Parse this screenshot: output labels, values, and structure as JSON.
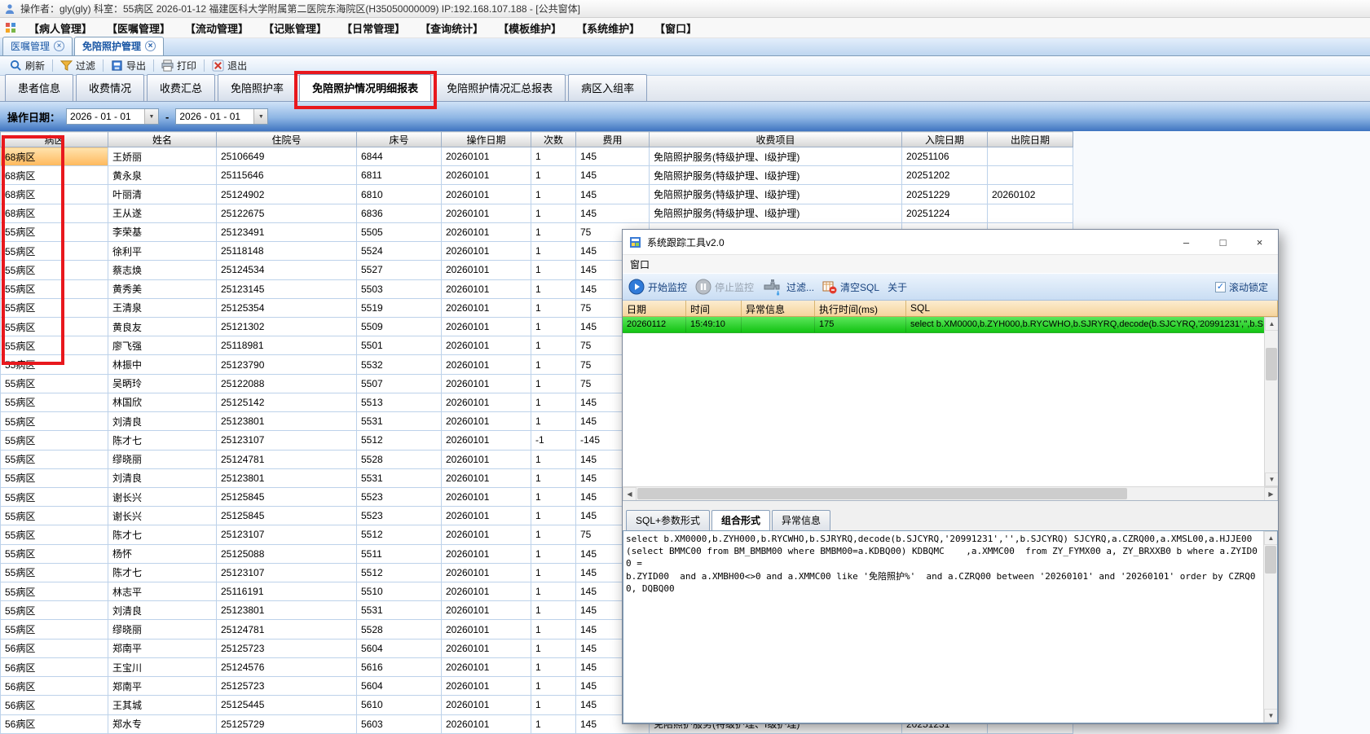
{
  "colors": {
    "annotation_red": "#e8181d",
    "selected_cell_orange": "#ffb85c",
    "trace_row_green": "#12c312",
    "filter_band_blue": "#3f74c0"
  },
  "icons": {
    "chevron_down": "▼",
    "scroll_left": "◀",
    "scroll_right": "▶",
    "scroll_up": "▲",
    "scroll_down": "▼",
    "check": "✓",
    "close": "×"
  },
  "titlebar": {
    "text": "操作者：gly(gly)  科室：55病区  2026-01-12  福建医科大学附属第二医院东海院区(H35050000009) IP:192.168.107.188 - [公共窗体]"
  },
  "menubar": {
    "items": [
      "【病人管理】",
      "【医嘱管理】",
      "【流动管理】",
      "【记账管理】",
      "【日常管理】",
      "【查询统计】",
      "【模板维护】",
      "【系统维护】",
      "【窗口】"
    ]
  },
  "doc_tabs": [
    {
      "label": "医嘱管理",
      "active": false
    },
    {
      "label": "免陪照护管理",
      "active": true
    }
  ],
  "toolbar": {
    "buttons": [
      {
        "name": "refresh",
        "label": "刷新",
        "icon": "magnifier-icon"
      },
      {
        "name": "filter",
        "label": "过滤",
        "icon": "funnel-icon"
      },
      {
        "name": "export",
        "label": "导出",
        "icon": "export-icon"
      },
      {
        "name": "print",
        "label": "打印",
        "icon": "print-icon"
      },
      {
        "name": "exit",
        "label": "退出",
        "icon": "exit-icon"
      }
    ]
  },
  "sub_tabs": [
    {
      "label": "患者信息",
      "active": false,
      "annotated": false
    },
    {
      "label": "收费情况",
      "active": false,
      "annotated": false
    },
    {
      "label": "收费汇总",
      "active": false,
      "annotated": false
    },
    {
      "label": "免陪照护率",
      "active": false,
      "annotated": false
    },
    {
      "label": "免陪照护情况明细报表",
      "active": true,
      "annotated": true
    },
    {
      "label": "免陪照护情况汇总报表",
      "active": false,
      "annotated": false
    },
    {
      "label": "病区入组率",
      "active": false,
      "annotated": false
    }
  ],
  "filter": {
    "label": "操作日期：",
    "from": "2026 - 01 - 01",
    "separator": "-",
    "to": "2026 - 01 - 01"
  },
  "table": {
    "columns": [
      "病区",
      "姓名",
      "住院号",
      "床号",
      "操作日期",
      "次数",
      "费用",
      "收费项目",
      "入院日期",
      "出院日期"
    ],
    "selected_cell": {
      "row": 0,
      "col": 0
    },
    "rows": [
      [
        "68病区",
        "王娇丽",
        "25106649",
        "6844",
        "20260101",
        "1",
        "145",
        "免陪照护服务(特级护理、I级护理)",
        "20251106",
        ""
      ],
      [
        "68病区",
        "黄永泉",
        "25115646",
        "6811",
        "20260101",
        "1",
        "145",
        "免陪照护服务(特级护理、I级护理)",
        "20251202",
        ""
      ],
      [
        "68病区",
        "叶丽清",
        "25124902",
        "6810",
        "20260101",
        "1",
        "145",
        "免陪照护服务(特级护理、I级护理)",
        "20251229",
        "20260102"
      ],
      [
        "68病区",
        "王从遂",
        "25122675",
        "6836",
        "20260101",
        "1",
        "145",
        "免陪照护服务(特级护理、I级护理)",
        "20251224",
        ""
      ],
      [
        "55病区",
        "李荣基",
        "25123491",
        "5505",
        "20260101",
        "1",
        "75",
        "",
        "",
        ""
      ],
      [
        "55病区",
        "徐利平",
        "25118148",
        "5524",
        "20260101",
        "1",
        "145",
        "",
        "",
        ""
      ],
      [
        "55病区",
        "蔡志焕",
        "25124534",
        "5527",
        "20260101",
        "1",
        "145",
        "",
        "",
        ""
      ],
      [
        "55病区",
        "黄秀美",
        "25123145",
        "5503",
        "20260101",
        "1",
        "145",
        "",
        "",
        ""
      ],
      [
        "55病区",
        "王清泉",
        "25125354",
        "5519",
        "20260101",
        "1",
        "75",
        "",
        "",
        ""
      ],
      [
        "55病区",
        "黄良友",
        "25121302",
        "5509",
        "20260101",
        "1",
        "145",
        "",
        "",
        ""
      ],
      [
        "55病区",
        "廖飞强",
        "25118981",
        "5501",
        "20260101",
        "1",
        "75",
        "",
        "",
        ""
      ],
      [
        "55病区",
        "林振中",
        "25123790",
        "5532",
        "20260101",
        "1",
        "75",
        "",
        "",
        ""
      ],
      [
        "55病区",
        "吴昞玲",
        "25122088",
        "5507",
        "20260101",
        "1",
        "75",
        "",
        "",
        ""
      ],
      [
        "55病区",
        "林国欣",
        "25125142",
        "5513",
        "20260101",
        "1",
        "145",
        "",
        "",
        ""
      ],
      [
        "55病区",
        "刘清良",
        "25123801",
        "5531",
        "20260101",
        "1",
        "145",
        "",
        "",
        ""
      ],
      [
        "55病区",
        "陈才七",
        "25123107",
        "5512",
        "20260101",
        "-1",
        "-145",
        "",
        "",
        ""
      ],
      [
        "55病区",
        "缪晓丽",
        "25124781",
        "5528",
        "20260101",
        "1",
        "145",
        "",
        "",
        ""
      ],
      [
        "55病区",
        "刘清良",
        "25123801",
        "5531",
        "20260101",
        "1",
        "145",
        "",
        "",
        ""
      ],
      [
        "55病区",
        "谢长兴",
        "25125845",
        "5523",
        "20260101",
        "1",
        "145",
        "",
        "",
        ""
      ],
      [
        "55病区",
        "谢长兴",
        "25125845",
        "5523",
        "20260101",
        "1",
        "145",
        "",
        "",
        ""
      ],
      [
        "55病区",
        "陈才七",
        "25123107",
        "5512",
        "20260101",
        "1",
        "75",
        "",
        "",
        ""
      ],
      [
        "55病区",
        "杨怀",
        "25125088",
        "5511",
        "20260101",
        "1",
        "145",
        "",
        "",
        ""
      ],
      [
        "55病区",
        "陈才七",
        "25123107",
        "5512",
        "20260101",
        "1",
        "145",
        "",
        "",
        ""
      ],
      [
        "55病区",
        "林志平",
        "25116191",
        "5510",
        "20260101",
        "1",
        "145",
        "",
        "",
        ""
      ],
      [
        "55病区",
        "刘清良",
        "25123801",
        "5531",
        "20260101",
        "1",
        "145",
        "",
        "",
        ""
      ],
      [
        "55病区",
        "缪晓丽",
        "25124781",
        "5528",
        "20260101",
        "1",
        "145",
        "",
        "",
        ""
      ],
      [
        "56病区",
        "郑南平",
        "25125723",
        "5604",
        "20260101",
        "1",
        "145",
        "",
        "",
        ""
      ],
      [
        "56病区",
        "王宝川",
        "25124576",
        "5616",
        "20260101",
        "1",
        "145",
        "",
        "",
        ""
      ],
      [
        "56病区",
        "郑南平",
        "25125723",
        "5604",
        "20260101",
        "1",
        "145",
        "",
        "",
        ""
      ],
      [
        "56病区",
        "王其城",
        "25125445",
        "5610",
        "20260101",
        "1",
        "145",
        "",
        "",
        ""
      ],
      [
        "56病区",
        "郑水专",
        "25125729",
        "5603",
        "20260101",
        "1",
        "145",
        "免陪照护服务(特级护理、I级护理)",
        "20251231",
        ""
      ]
    ]
  },
  "dialog": {
    "title": "系统跟踪工具v2.0",
    "window_buttons": {
      "minimize": "–",
      "maximize": "□",
      "close": "×"
    },
    "menu_items": [
      "窗口"
    ],
    "toolbar": {
      "start": "开始监控",
      "stop": "停止监控",
      "filter": "过滤...",
      "clear": "清空SQL",
      "about": "关于",
      "scroll_lock": "滚动锁定",
      "scroll_lock_checked": true
    },
    "grid": {
      "columns": [
        "日期",
        "时间",
        "异常信息",
        "执行时间(ms)",
        "SQL"
      ],
      "rows": [
        [
          "20260112",
          "15:49:10",
          "",
          "175",
          "select b.XM0000,b.ZYH000,b.RYCWHO,b.SJRYRQ,decode(b.SJCYRQ,'20991231','',b.S"
        ]
      ]
    },
    "tabs": [
      {
        "label": "SQL+参数形式",
        "active": false
      },
      {
        "label": "组合形式",
        "active": true
      },
      {
        "label": "异常信息",
        "active": false
      }
    ],
    "sql_text": "select b.XM0000,b.ZYH000,b.RYCWHO,b.SJRYRQ,decode(b.SJCYRQ,'20991231','',b.SJCYRQ) SJCYRQ,a.CZRQ00,a.XMSL00,a.HJJE00\n(select BMMC00 from BM_BMBM00 where BMBM00=a.KDBQ00) KDBQMC    ,a.XMMC00  from ZY_FYMX00 a, ZY_BRXXB0 b where a.ZYID00 =\nb.ZYID00  and a.XMBH00<>0 and a.XMMC00 like '免陪照护%'  and a.CZRQ00 between '20260101' and '20260101' order by CZRQ00, DQBQ00"
  }
}
